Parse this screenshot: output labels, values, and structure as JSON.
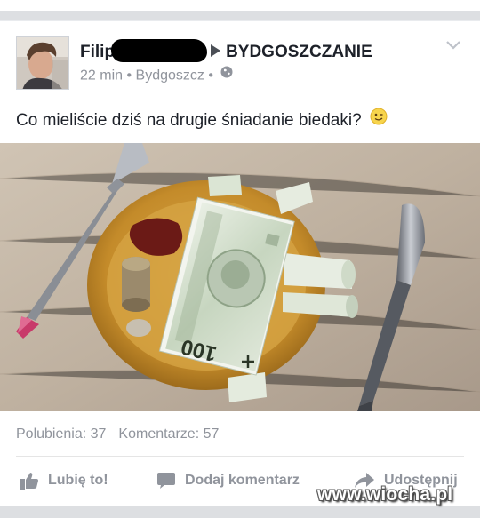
{
  "post": {
    "author_visible": "Filip",
    "target_group": "BYDGOSZCZANIE",
    "time": "22 min",
    "location": "Bydgoszcz",
    "text": "Co mieliście dziś na drugie śniadanie biedaki?"
  },
  "photo": {
    "banknote_value": "100"
  },
  "stats": {
    "likes": "Polubienia: 37",
    "comments": "Komentarze: 57"
  },
  "actions": {
    "like": "Lubię to!",
    "comment": "Dodaj komentarz",
    "share": "Udostępnij"
  },
  "watermark": "www.wiocha.pl",
  "icons": {
    "privacy": "globe-icon",
    "menu": "chevron-down-icon",
    "emoji": "wink-emoji-icon",
    "like": "thumbs-up-icon",
    "comment": "speech-bubble-icon",
    "share": "share-arrow-icon"
  },
  "colors": {
    "text": "#1d2129",
    "secondary": "#90949c",
    "background": "#e9ebee"
  }
}
